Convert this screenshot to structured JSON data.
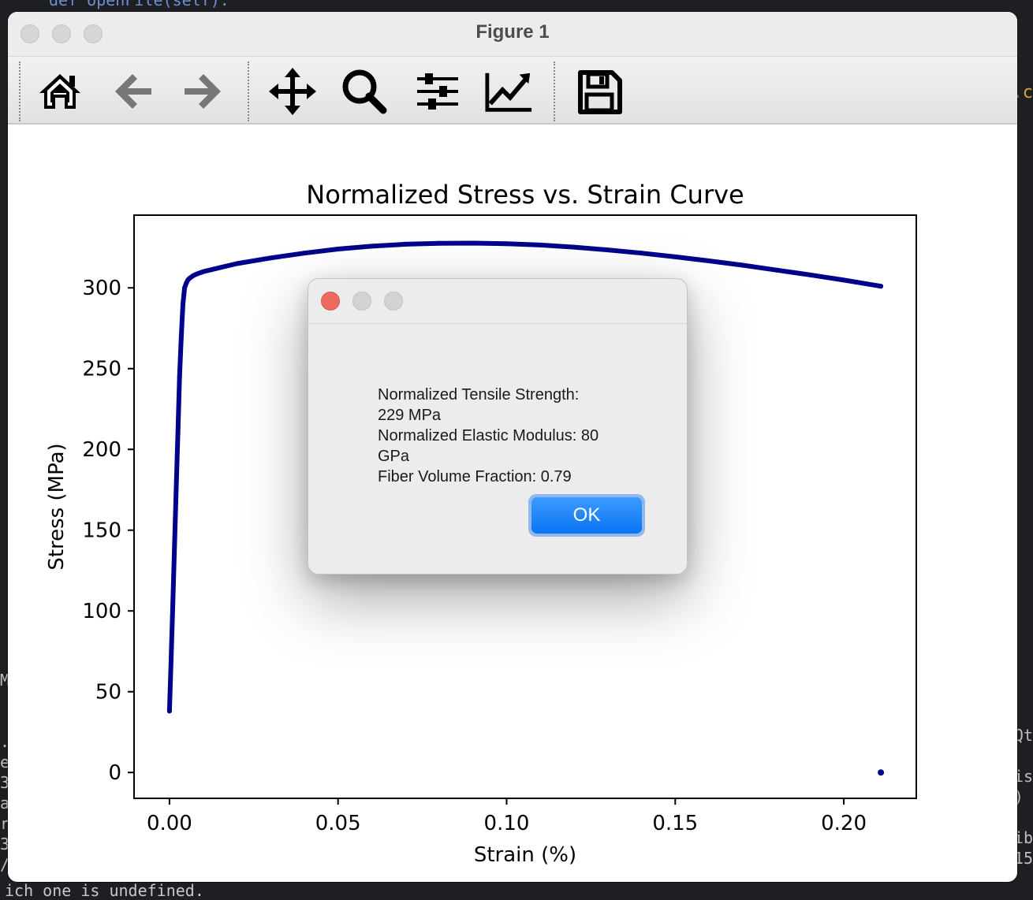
{
  "background": {
    "code_line": "def openFile(self):",
    "terminal_line": "ich one is undefined.",
    "right_dot": ".c",
    "left_edge": [
      "M",
      "",
      "",
      ".",
      "e",
      "3",
      "a",
      "r",
      "3",
      "/"
    ],
    "right_edge": [
      "Qt",
      "",
      "is",
      ")",
      "",
      "ib",
      "15"
    ]
  },
  "window": {
    "title": "Figure 1"
  },
  "toolbar": {
    "buttons": [
      "home-icon",
      "back-arrow-icon",
      "forward-arrow-icon",
      "pan-icon",
      "zoom-icon",
      "sliders-icon",
      "line-chart-icon",
      "floppy-disk-icon"
    ]
  },
  "chart_data": {
    "type": "scatter",
    "title": "Normalized Stress vs. Strain Curve",
    "xlabel": "Strain (%)",
    "ylabel": "Stress (MPa)",
    "xlim": [
      -0.0105,
      0.2215
    ],
    "ylim": [
      -16,
      345
    ],
    "xticks": [
      0.0,
      0.05,
      0.1,
      0.15,
      0.2
    ],
    "xtick_labels": [
      "0.00",
      "0.05",
      "0.10",
      "0.15",
      "0.20"
    ],
    "yticks": [
      0,
      50,
      100,
      150,
      200,
      250,
      300
    ],
    "ytick_labels": [
      "0",
      "50",
      "100",
      "150",
      "200",
      "250",
      "300"
    ],
    "grid": false,
    "marker_color": "#00008b",
    "series": [
      {
        "x": [
          0.0,
          0.0005,
          0.001,
          0.0015,
          0.002,
          0.0025,
          0.003,
          0.0035,
          0.004,
          0.0045,
          0.005,
          0.0055,
          0.006,
          0.007,
          0.008,
          0.01,
          0.015,
          0.02,
          0.03,
          0.04,
          0.05,
          0.06,
          0.07,
          0.08,
          0.09,
          0.1,
          0.11,
          0.12,
          0.13,
          0.14,
          0.15,
          0.16,
          0.17,
          0.18,
          0.19,
          0.2,
          0.211
        ],
        "y": [
          38,
          70,
          105,
          140,
          175,
          210,
          245,
          270,
          290,
          300,
          303,
          305,
          306,
          307.5,
          308.5,
          310,
          312.5,
          315,
          318.5,
          321.5,
          324,
          325.8,
          327,
          327.6,
          327.7,
          327.3,
          326.5,
          325.2,
          323.5,
          321.5,
          319.2,
          316.7,
          314,
          311,
          308,
          304.8,
          301
        ]
      },
      {
        "x": [
          0.211
        ],
        "y": [
          0
        ]
      }
    ]
  },
  "dialog": {
    "lines": [
      "Normalized Tensile Strength:",
      "229 MPa",
      "Normalized Elastic Modulus: 80",
      "GPa",
      "Fiber Volume Fraction: 0.79"
    ],
    "ok_label": "OK",
    "close_color": "#ed6a5e"
  }
}
